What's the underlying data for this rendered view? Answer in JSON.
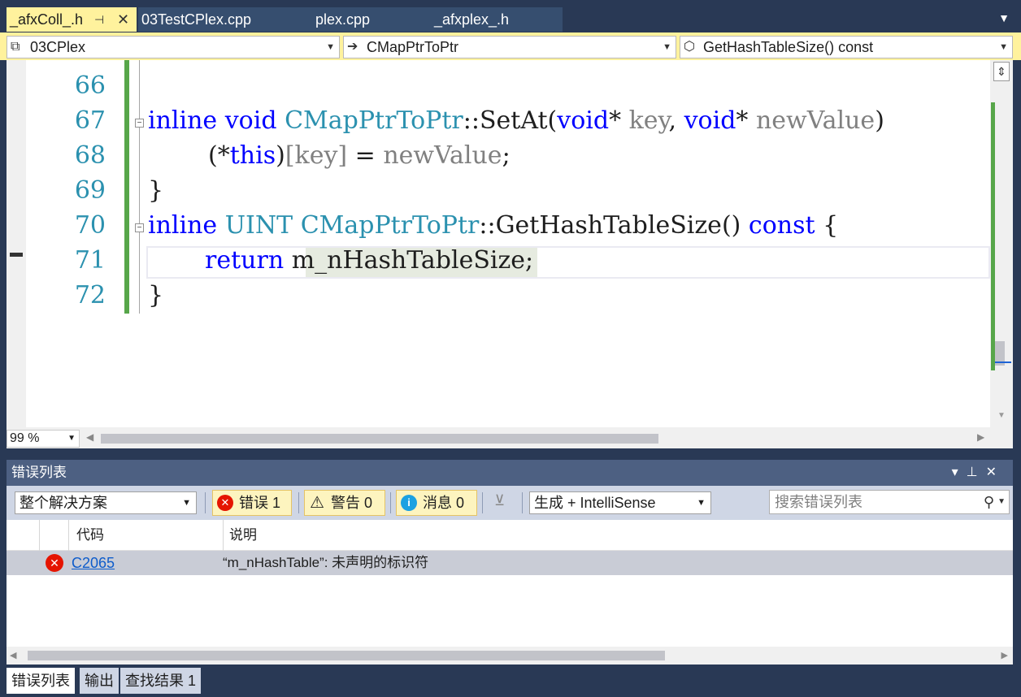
{
  "tabs": [
    {
      "label": "_afxColl_.h",
      "active": true
    },
    {
      "label": "03TestCPlex.cpp",
      "active": false
    },
    {
      "label": "plex.cpp",
      "active": false
    },
    {
      "label": "_afxplex_.h",
      "active": false
    }
  ],
  "nav": {
    "project": "03CPlex",
    "scope": "CMapPtrToPtr",
    "member": "GetHashTableSize() const"
  },
  "editor": {
    "line_numbers": [
      "66",
      "67",
      "68",
      "69",
      "70",
      "71",
      "72"
    ],
    "lines": {
      "l67": {
        "kw1": "inline",
        "kw2": "void",
        "cls": "CMapPtrToPtr",
        "fn": "::SetAt(",
        "kw3": "void",
        "p1": "*",
        "a1": "key",
        "c1": ", ",
        "kw4": "void",
        "p2": "*",
        "a2": "newValue",
        "end": ")"
      },
      "l68": {
        "open": "(*",
        "kw": "this",
        "mid": ")",
        "idx": "[key]",
        "eq": " = ",
        "val": "newValue",
        "end": ";"
      },
      "l69": "}",
      "l70": {
        "kw1": "inline",
        "ty": "UINT",
        "cls": "CMapPtrToPtr",
        "fn": "::GetHashTableSize()",
        "kw2": "const",
        "brace": "{"
      },
      "l71": {
        "kw": "return",
        "id": "m_nHashTableSize",
        "end": ";"
      },
      "l72": "}"
    },
    "zoom": "99 %"
  },
  "error_list": {
    "title": "错误列表",
    "scope_filter": "整个解决方案",
    "errors_btn": "错误 1",
    "warnings_btn": "警告 0",
    "messages_btn": "消息 0",
    "build_filter": "生成 + IntelliSense",
    "search_placeholder": "搜索错误列表",
    "columns": {
      "code": "代码",
      "description": "说明"
    },
    "rows": [
      {
        "code": "C2065",
        "description": "“m_nHashTable”: 未声明的标识符"
      }
    ]
  },
  "bottom_tabs": [
    "错误列表",
    "输出",
    "查找结果 1"
  ],
  "icons": {
    "pin": "pin-icon",
    "close": "close-icon",
    "error": "error-icon",
    "warning": "warning-icon",
    "info": "info-icon",
    "search": "search-icon"
  },
  "colors": {
    "active_tab": "#fff29d",
    "chrome": "#293955",
    "error_red": "#e51400",
    "keyword_blue": "#0000ff",
    "type_teal": "#2b91af",
    "change_green": "#57a64a"
  }
}
